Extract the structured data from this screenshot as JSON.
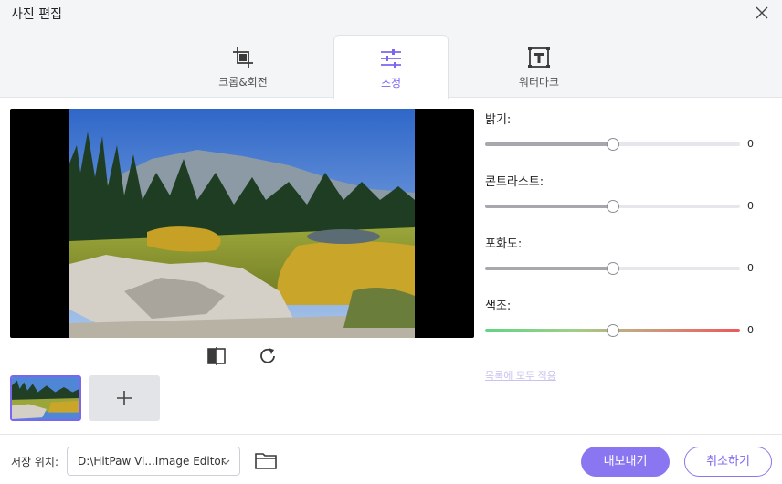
{
  "window": {
    "title": "사진 편집"
  },
  "tabs": [
    {
      "label": "크롭&회전",
      "icon": "crop-icon",
      "active": false
    },
    {
      "label": "조정",
      "icon": "sliders-icon",
      "active": true
    },
    {
      "label": "워터마크",
      "icon": "watermark-icon",
      "active": false
    }
  ],
  "adjustments": [
    {
      "label": "밝기:",
      "value": "0",
      "level": 0.5
    },
    {
      "label": "콘트라스트:",
      "value": "0",
      "level": 0.5
    },
    {
      "label": "포화도:",
      "value": "0",
      "level": 0.5
    },
    {
      "label": "색조:",
      "value": "0",
      "level": 0.5
    }
  ],
  "apply_all": "목록에 모두 적용",
  "footer": {
    "save_location_label": "저장 위치:",
    "save_path": "D:\\HitPaw Vi...Image Editor",
    "export_label": "내보내기",
    "cancel_label": "취소하기"
  },
  "colors": {
    "accent": "#8b76f2",
    "hue_start": "#5fd585",
    "hue_end": "#f0565a"
  }
}
